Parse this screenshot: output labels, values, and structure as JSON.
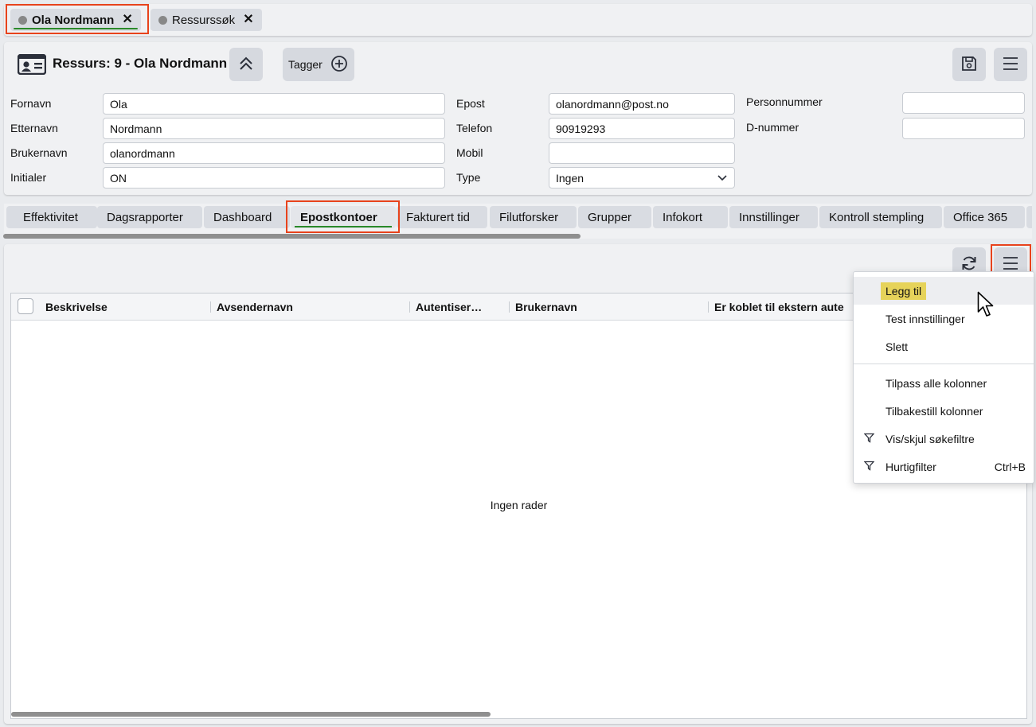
{
  "doc_tabs": [
    {
      "label": "Ola Nordmann",
      "close": "✕",
      "active": true
    },
    {
      "label": "Ressurssøk",
      "close": "✕",
      "active": false
    }
  ],
  "header": {
    "title": "Ressurs: 9 - Ola Nordmann",
    "tags_label": "Tagger"
  },
  "form": {
    "fornavn_label": "Fornavn",
    "fornavn": "Ola",
    "etternavn_label": "Etternavn",
    "etternavn": "Nordmann",
    "brukernavn_label": "Brukernavn",
    "brukernavn": "olanordmann",
    "initialer_label": "Initialer",
    "initialer": "ON",
    "epost_label": "Epost",
    "epost": "olanordmann@post.no",
    "telefon_label": "Telefon",
    "telefon": "90919293",
    "mobil_label": "Mobil",
    "mobil": "",
    "type_label": "Type",
    "type": "Ingen",
    "personnummer_label": "Personnummer",
    "personnummer": "",
    "dnummer_label": "D-nummer",
    "dnummer": ""
  },
  "sub_tabs": [
    "Effektivitet",
    "Dagsrapporter",
    "Dashboard",
    "Epostkontoer",
    "Fakturert tid",
    "Filutforsker",
    "Grupper",
    "Infokort",
    "Innstillinger",
    "Kontroll stempling",
    "Office 365"
  ],
  "active_sub_tab": "Epostkontoer",
  "grid": {
    "columns": [
      "Beskrivelse",
      "Avsendernavn",
      "Autentiser…",
      "Brukernavn",
      "Er koblet til ekstern aute"
    ],
    "empty_text": "Ingen rader"
  },
  "menu": {
    "items": [
      {
        "label": "Legg til",
        "icon": "",
        "shortcut": ""
      },
      {
        "label": "Test innstillinger",
        "icon": "",
        "shortcut": ""
      },
      {
        "label": "Slett",
        "icon": "",
        "shortcut": ""
      },
      {
        "label": "Tilpass alle kolonner",
        "icon": "",
        "shortcut": ""
      },
      {
        "label": "Tilbakestill kolonner",
        "icon": "",
        "shortcut": ""
      },
      {
        "label": "Vis/skjul søkefiltre",
        "icon": "filter-icon",
        "shortcut": ""
      },
      {
        "label": "Hurtigfilter",
        "icon": "filter-icon",
        "shortcut": "Ctrl+B"
      }
    ]
  },
  "colors": {
    "accent_green": "#2a8a2a",
    "highlight_red": "#e8431c",
    "menu_highlight": "#e6d35a"
  }
}
